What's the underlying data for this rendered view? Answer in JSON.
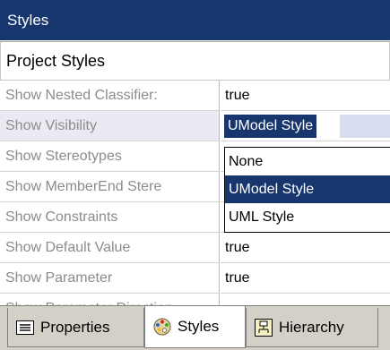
{
  "panel": {
    "title": "Styles"
  },
  "project_selector": {
    "value": "Project Styles"
  },
  "properties": [
    {
      "label": "Show Nested Classifier:",
      "value": "true"
    },
    {
      "label": "Show Visibility",
      "value": "UModel Style"
    },
    {
      "label": "Show Stereotypes",
      "value": ""
    },
    {
      "label": "Show MemberEnd Stere",
      "value": ""
    },
    {
      "label": "Show Constraints",
      "value": ""
    },
    {
      "label": "Show Default Value",
      "value": "true"
    },
    {
      "label": "Show Parameter",
      "value": "true"
    },
    {
      "label": "Show Parameter Direction",
      "value": ""
    }
  ],
  "dropdown": {
    "options": [
      "None",
      "UModel Style",
      "UML Style"
    ],
    "highlighted": "UModel Style"
  },
  "tabs": [
    {
      "label": "Properties",
      "icon": "properties-icon"
    },
    {
      "label": "Styles",
      "icon": "palette-icon",
      "active": true
    },
    {
      "label": "Hierarchy",
      "icon": "hierarchy-icon"
    }
  ],
  "colors": {
    "title_bg": "#17366e",
    "selection": "#17366e"
  }
}
